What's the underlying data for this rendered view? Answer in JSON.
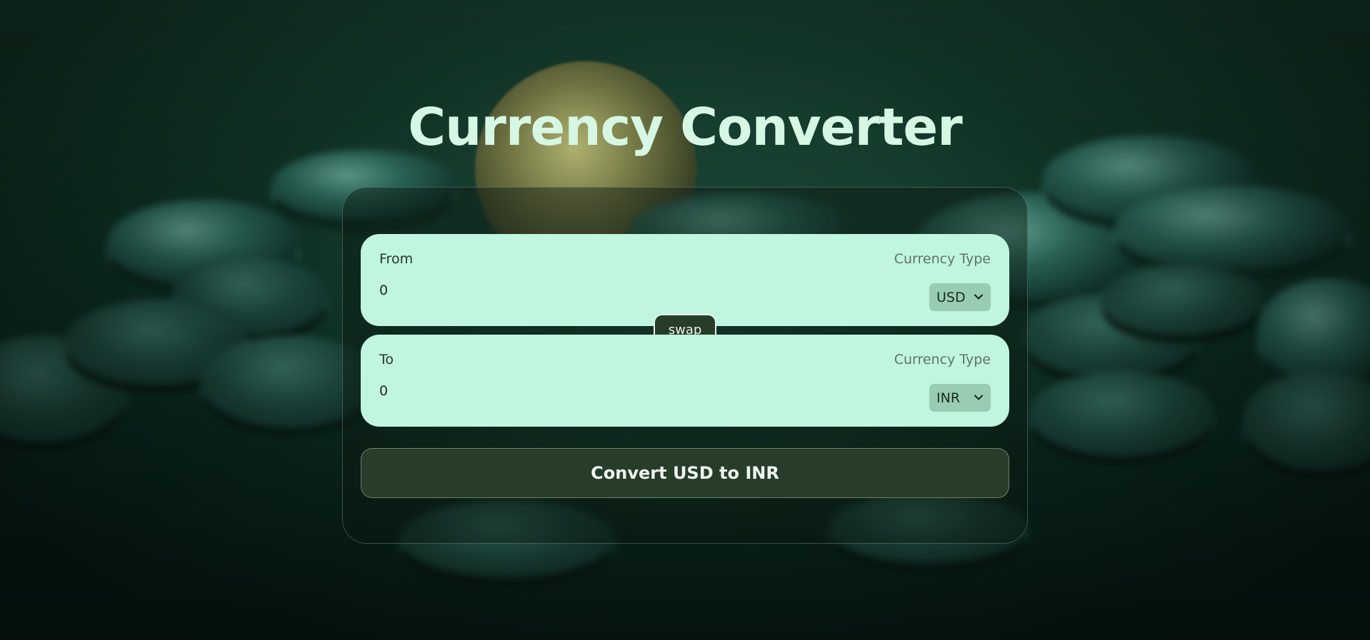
{
  "page": {
    "title": "Currency Converter"
  },
  "from": {
    "label": "From",
    "amount": "0",
    "currency_type_label": "Currency Type",
    "currency": "USD"
  },
  "swap": {
    "label": "swap"
  },
  "to": {
    "label": "To",
    "amount": "0",
    "currency_type_label": "Currency Type",
    "currency": "INR"
  },
  "convert": {
    "label": "Convert USD to INR"
  },
  "colors": {
    "accent_dark": "#273d2a",
    "field_bg": "#c0f6df",
    "select_bg": "#98cdb4",
    "title": "#d6f7e3"
  },
  "icons": {
    "select_chevron": "chevron-down-icon"
  }
}
